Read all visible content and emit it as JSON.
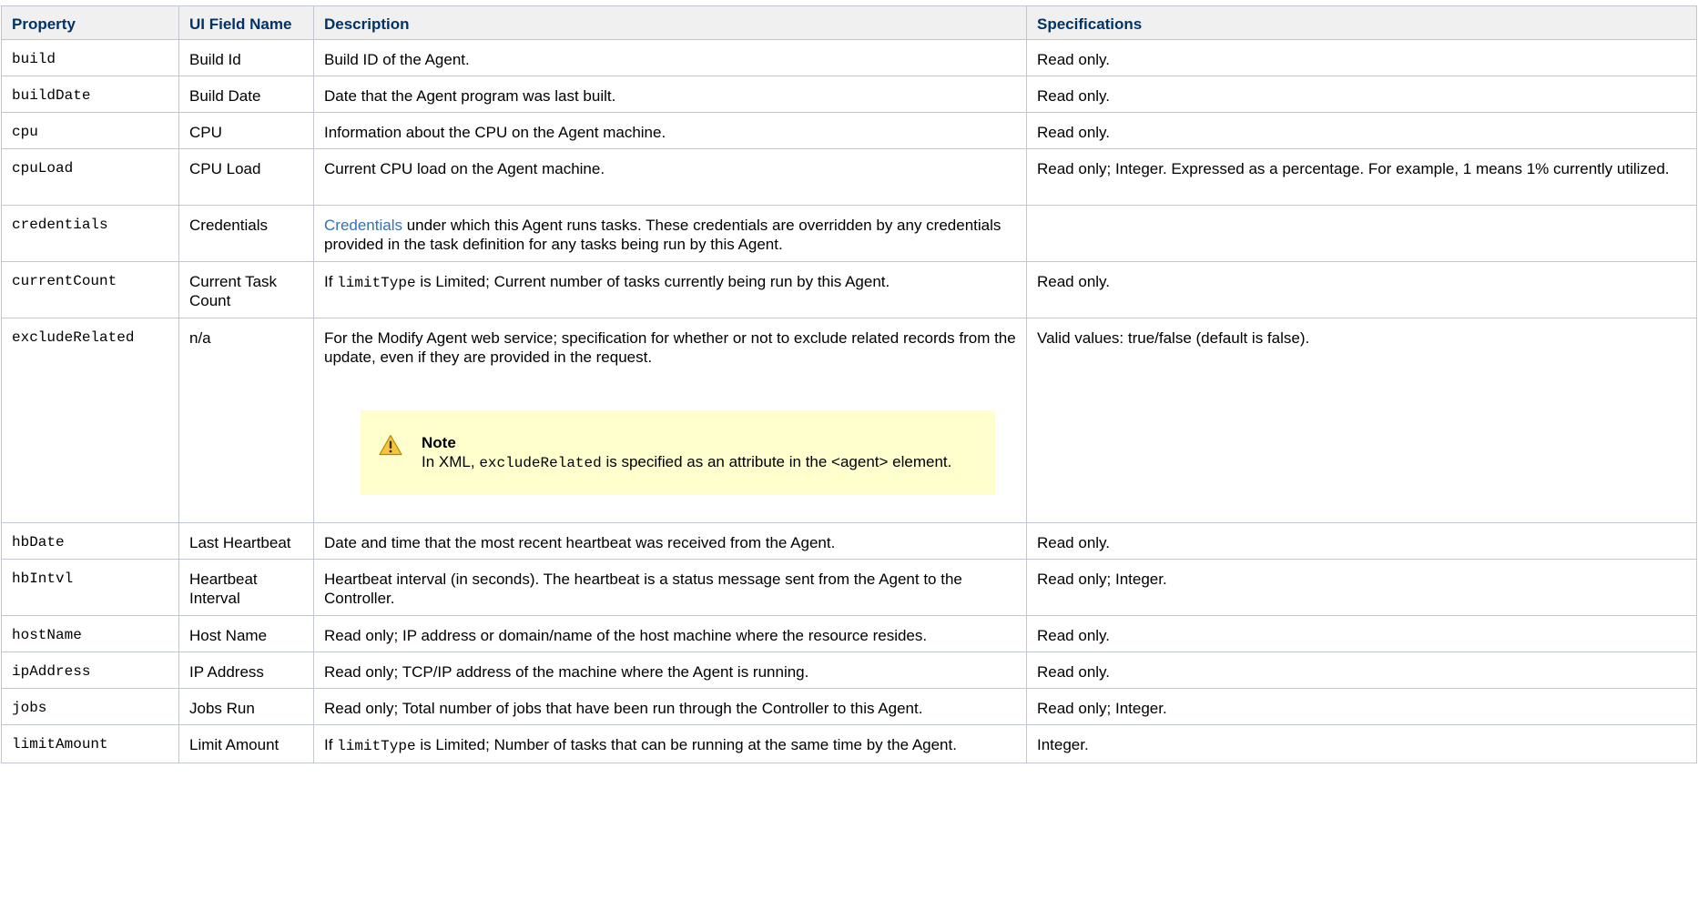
{
  "headers": {
    "property": "Property",
    "ui_field": "UI Field Name",
    "description": "Description",
    "specs": "Specifications"
  },
  "rows": [
    {
      "property": "build",
      "ui_field": "Build Id",
      "description": "Build ID of the Agent.",
      "specs": "Read only."
    },
    {
      "property": "buildDate",
      "ui_field": "Build Date",
      "description": "Date that the Agent program was last built.",
      "specs": "Read only."
    },
    {
      "property": "cpu",
      "ui_field": "CPU",
      "description": "Information about the CPU on the Agent machine.",
      "specs": "Read only."
    },
    {
      "property": "cpuLoad",
      "ui_field": "CPU Load",
      "description": "Current CPU load on the Agent machine.",
      "specs": "Read only; Integer. Expressed as a percentage. For example, 1 means 1% currently utilized."
    },
    {
      "property": "credentials",
      "ui_field": "Credentials",
      "description_link": "Credentials",
      "description_rest": " under which this Agent runs tasks. These credentials are overridden by any credentials provided in the task definition for any tasks being run by this Agent.",
      "specs": ""
    },
    {
      "property": "currentCount",
      "ui_field": "Current Task Count",
      "description_prefix": "If ",
      "description_code": "limitType",
      "description_rest": " is Limited; Current number of tasks currently being run by this Agent.",
      "specs": "Read only."
    },
    {
      "property": "excludeRelated",
      "ui_field": "n/a",
      "description": "For the Modify Agent web service; specification for whether or not to exclude related records from the update, even if they are provided in the request.",
      "specs": "Valid values: true/false (default is false).",
      "note": {
        "icon": "warning-icon",
        "title": "Note",
        "prefix": "In XML, ",
        "code": "excludeRelated",
        "rest": " is specified as an attribute in the <agent> element."
      }
    },
    {
      "property": "hbDate",
      "ui_field": "Last Heartbeat",
      "description": "Date and time that the most recent heartbeat was received from the Agent.",
      "specs": "Read only."
    },
    {
      "property": "hbIntvl",
      "ui_field": "Heartbeat Interval",
      "description": "Heartbeat interval (in seconds). The heartbeat is a status message sent from the Agent to the Controller.",
      "specs": "Read only; Integer."
    },
    {
      "property": "hostName",
      "ui_field": "Host Name",
      "description": "Read only; IP address or domain/name of the host machine where the resource resides.",
      "specs": "Read only."
    },
    {
      "property": "ipAddress",
      "ui_field": "IP Address",
      "description": "Read only; TCP/IP address of the machine where the Agent is running.",
      "specs": "Read only."
    },
    {
      "property": "jobs",
      "ui_field": "Jobs Run",
      "description": "Read only; Total number of jobs that have been run through the Controller to this Agent.",
      "specs": "Read only; Integer."
    },
    {
      "property": "limitAmount",
      "ui_field": "Limit Amount",
      "description_prefix": "If ",
      "description_code": "limitType",
      "description_rest": " is Limited; Number of tasks that can be running at the same time by the Agent.",
      "specs": "Integer."
    }
  ],
  "colors": {
    "header_text": "#003366",
    "header_bg": "#f0f0f0",
    "border": "#c1c7d0",
    "link": "#3572b0",
    "note_bg": "#ffffce",
    "warning_icon": "#f6c342"
  }
}
